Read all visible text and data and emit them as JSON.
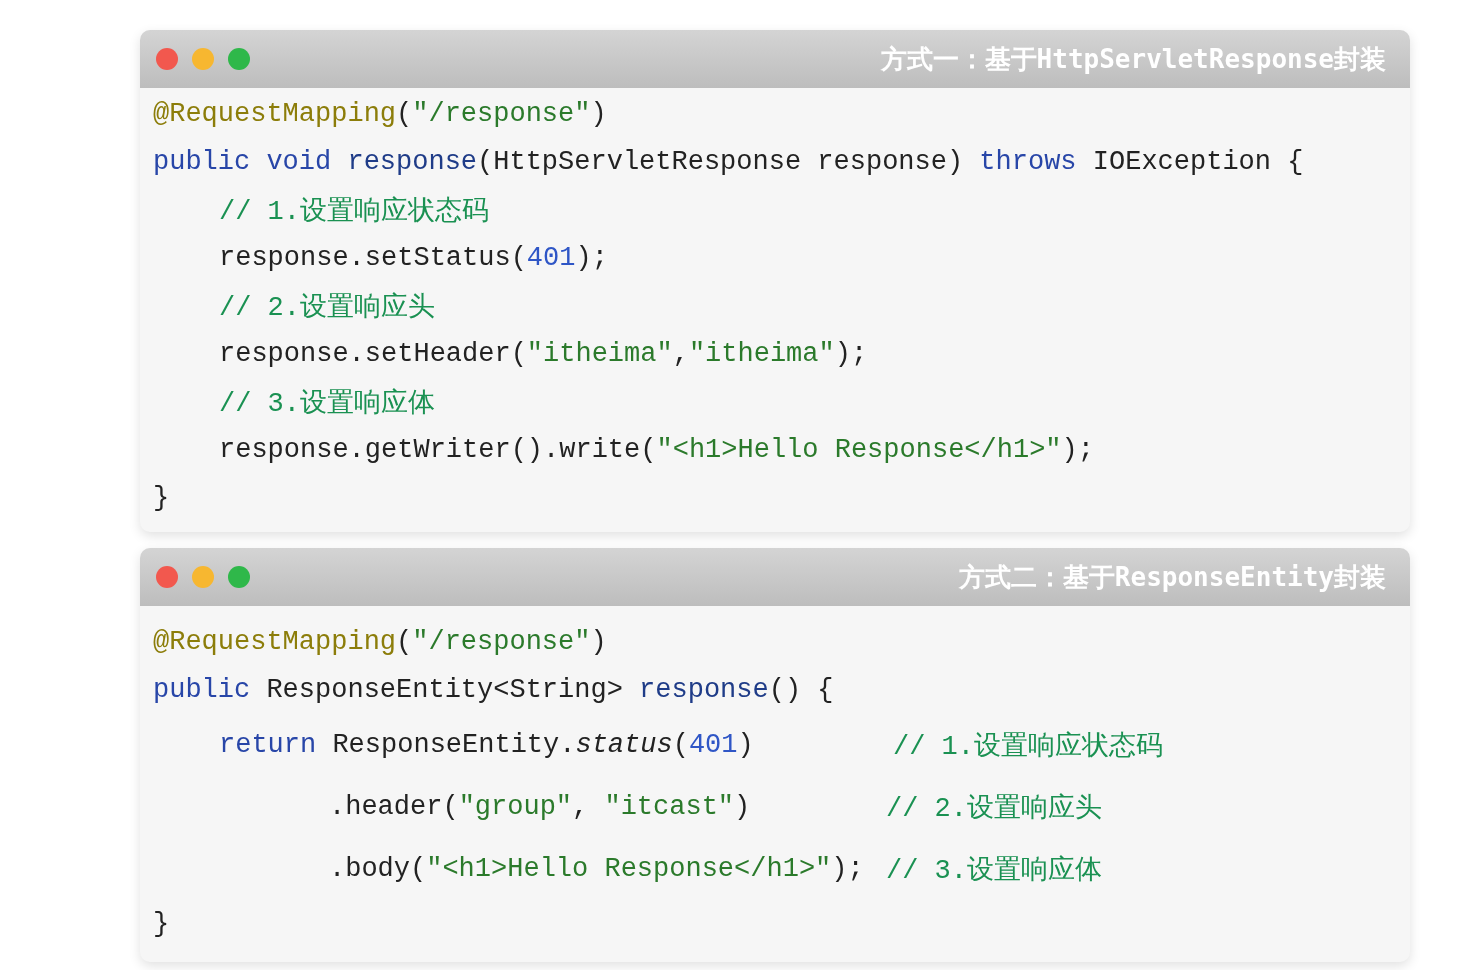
{
  "windows": [
    {
      "title": "方式一：基于HttpServletResponse封装",
      "lines": [
        {
          "tokens": [
            {
              "text": "@RequestMapping",
              "kind": "annotation"
            },
            {
              "text": "(",
              "kind": "plain"
            },
            {
              "text": "\"/response\"",
              "kind": "string"
            },
            {
              "text": ")",
              "kind": "plain"
            }
          ]
        },
        {
          "tokens": [
            {
              "text": "public void ",
              "kind": "keyword"
            },
            {
              "text": "response",
              "kind": "method"
            },
            {
              "text": "(HttpServletResponse response) ",
              "kind": "plain"
            },
            {
              "text": "throws",
              "kind": "keyword"
            },
            {
              "text": " IOException {",
              "kind": "plain"
            }
          ],
          "children": [
            {
              "tokens": [
                {
                  "text": "// 1.设置响应状态码",
                  "kind": "comment"
                }
              ]
            },
            {
              "tokens": [
                {
                  "text": "response.setStatus(",
                  "kind": "plain"
                },
                {
                  "text": "401",
                  "kind": "number"
                },
                {
                  "text": ");",
                  "kind": "plain"
                }
              ]
            },
            {
              "tokens": [
                {
                  "text": "// 2.设置响应头",
                  "kind": "comment"
                }
              ]
            },
            {
              "tokens": [
                {
                  "text": "response.setHeader(",
                  "kind": "plain"
                },
                {
                  "text": "\"itheima\"",
                  "kind": "string"
                },
                {
                  "text": ",",
                  "kind": "plain"
                },
                {
                  "text": "\"itheima\"",
                  "kind": "string"
                },
                {
                  "text": ");",
                  "kind": "plain"
                }
              ]
            },
            {
              "tokens": [
                {
                  "text": "// 3.设置响应体",
                  "kind": "comment"
                }
              ]
            },
            {
              "tokens": [
                {
                  "text": "response.getWriter().write(",
                  "kind": "plain"
                },
                {
                  "text": "\"<h1>Hello Response</h1>\"",
                  "kind": "string"
                },
                {
                  "text": ");",
                  "kind": "plain"
                }
              ]
            }
          ]
        },
        {
          "tokens": [
            {
              "text": "}",
              "kind": "plain"
            }
          ]
        }
      ]
    },
    {
      "title": "方式二：基于ResponseEntity封装",
      "lines": [
        {
          "tokens": [
            {
              "text": "@RequestMapping",
              "kind": "annotation"
            },
            {
              "text": "(",
              "kind": "plain"
            },
            {
              "text": "\"/response\"",
              "kind": "string"
            },
            {
              "text": ")",
              "kind": "plain"
            }
          ]
        },
        {
          "tokens": [
            {
              "text": "public",
              "kind": "keyword"
            },
            {
              "text": " ResponseEntity<String> ",
              "kind": "plain"
            },
            {
              "text": "response",
              "kind": "method"
            },
            {
              "text": "() {",
              "kind": "plain"
            }
          ],
          "children": [
            {
              "tokens": [
                {
                  "text": "return",
                  "kind": "keyword"
                },
                {
                  "text": " ResponseEntity.",
                  "kind": "plain"
                },
                {
                  "text": "status",
                  "kind": "italic"
                },
                {
                  "text": "(",
                  "kind": "plain"
                },
                {
                  "text": "401",
                  "kind": "number"
                },
                {
                  "text": ")",
                  "kind": "plain"
                }
              ],
              "comment": "// 1.设置响应状态码",
              "children": [
                {
                  "tokens": [
                    {
                      "text": ".header(",
                      "kind": "plain"
                    },
                    {
                      "text": "\"group\"",
                      "kind": "string"
                    },
                    {
                      "text": ", ",
                      "kind": "plain"
                    },
                    {
                      "text": "\"itcast\"",
                      "kind": "string"
                    },
                    {
                      "text": ")",
                      "kind": "plain"
                    }
                  ],
                  "comment": "// 2.设置响应头"
                },
                {
                  "tokens": [
                    {
                      "text": ".body(",
                      "kind": "plain"
                    },
                    {
                      "text": "\"<h1>Hello Response</h1>\"",
                      "kind": "string"
                    },
                    {
                      "text": ");",
                      "kind": "plain"
                    }
                  ],
                  "comment": "// 3.设置响应体"
                }
              ]
            }
          ]
        },
        {
          "tokens": [
            {
              "text": "}",
              "kind": "plain"
            }
          ]
        }
      ]
    }
  ]
}
